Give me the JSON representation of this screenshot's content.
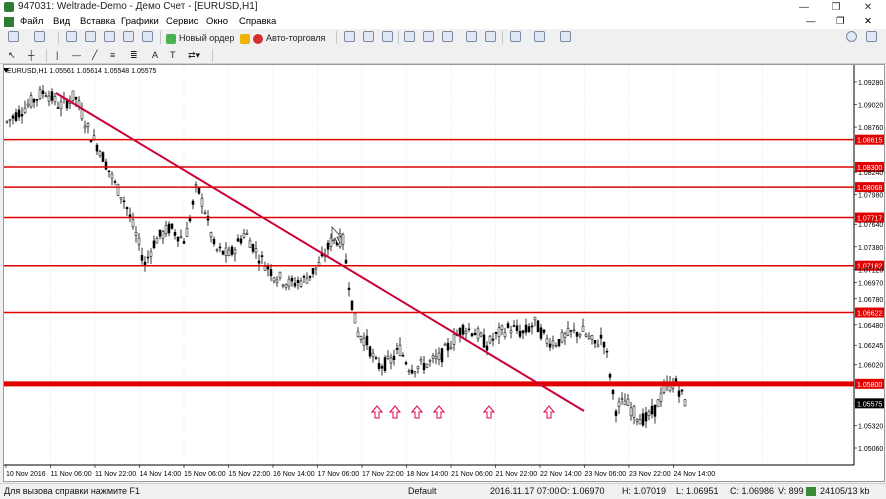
{
  "window": {
    "title": "947031: Weltrade-Demo - Демо Счет - [EURUSD,H1]"
  },
  "menu": [
    "Файл",
    "Вид",
    "Вставка",
    "Графики",
    "Сервис",
    "Окно",
    "Справка"
  ],
  "toolbar": {
    "new_order": "Новый ордер",
    "autotrading": "Авто-торговля"
  },
  "timeframes": [
    "M1",
    "M5",
    "M15",
    "M30",
    "H1",
    "H4",
    "D1",
    "W1",
    "MN"
  ],
  "active_timeframe": "H1",
  "chart_header": "EURUSD,H1  1.05561 1.05614 1.05548 1.05575",
  "price_labels": [
    "1.09280",
    "1.09020",
    "1.08760",
    "1.08240",
    "1.07980",
    "1.07640",
    "1.07380",
    "1.07120",
    "1.06970",
    "1.06780",
    "1.06480",
    "1.06245",
    "1.06020",
    "1.05575",
    "1.05320",
    "1.05060"
  ],
  "level_tags": [
    "1.08615",
    "1.08300",
    "1.08068",
    "1.07717",
    "1.07162",
    "1.06622",
    "1.05800"
  ],
  "current_price": "1.05575",
  "time_labels": [
    "10 Nov 2016",
    "11 Nov 06:00",
    "11 Nov 22:00",
    "14 Nov 14:00",
    "15 Nov 06:00",
    "15 Nov 22:00",
    "16 Nov 14:00",
    "17 Nov 06:00",
    "17 Nov 22:00",
    "18 Nov 14:00",
    "21 Nov 06:00",
    "21 Nov 22:00",
    "22 Nov 14:00",
    "23 Nov 06:00",
    "23 Nov 22:00",
    "24 Nov 14:00"
  ],
  "status": {
    "help": "Для вызова справки нажмите F1",
    "profile": "Default",
    "datetime": "2016.11.17 07:00",
    "open": "O: 1.06970",
    "high": "H: 1.07019",
    "low": "L: 1.06951",
    "close": "C: 1.06986",
    "volume": "V: 899",
    "traffic": "24105/13 kb"
  },
  "colors": {
    "level_line": "#e00000",
    "trend_line": "#cc0033",
    "candles": "#000000",
    "tag_bg": "#e00000",
    "price_tag_bg": "#000000"
  }
}
